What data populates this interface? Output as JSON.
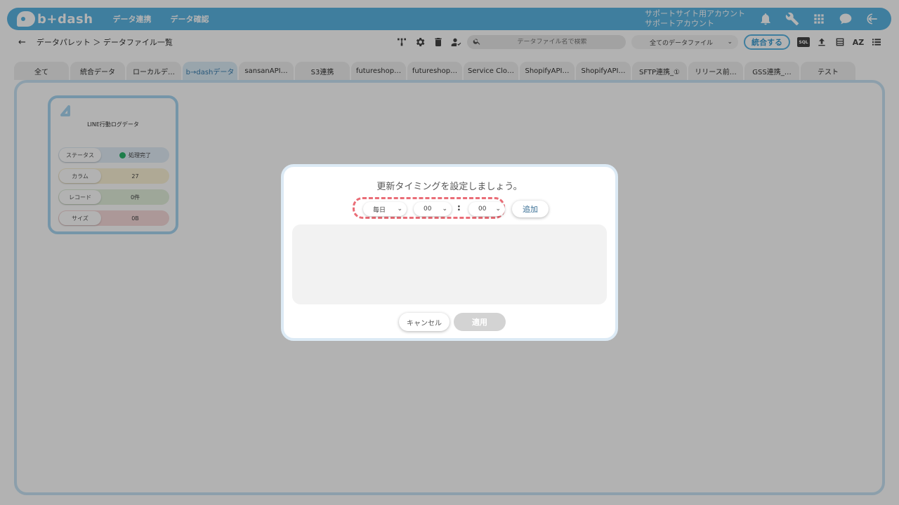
{
  "header": {
    "logo_text": "b+dash",
    "nav": [
      "データ連携",
      "データ確認"
    ],
    "account_line1": "サポートサイト用アカウント",
    "account_line2": "サポートアカウント",
    "icons": [
      "bell-icon",
      "wrench-icon",
      "grid-icon",
      "chat-icon",
      "logout-icon"
    ]
  },
  "subbar": {
    "back_icon": "←",
    "breadcrumb": "データパレット ＞ データファイル一覧",
    "search_placeholder": "データファイル名で検索",
    "filter_value": "全てのデータファイル",
    "merge_label": "統合する",
    "sql_label": "SQL"
  },
  "tabs": [
    "全て",
    "統合データ",
    "ローカルデ…",
    "b→dashデータ",
    "sansanAPI…",
    "S3連携",
    "futureshop…",
    "futureshop…",
    "Service Clo…",
    "ShopifyAPI…",
    "ShopifyAPI…",
    "SFTP連携_①",
    "リリース前…",
    "GSS連携_…",
    "テスト"
  ],
  "active_tab_index": 3,
  "card": {
    "title": "LINE行動ログデータ",
    "rows": [
      {
        "label": "ステータス",
        "value": "処理完了"
      },
      {
        "label": "カラム",
        "value": "27"
      },
      {
        "label": "レコード",
        "value": "0件"
      },
      {
        "label": "サイズ",
        "value": "0B"
      }
    ]
  },
  "modal": {
    "title": "更新タイミングを設定しましょう。",
    "frequency": "毎日",
    "hour": "00",
    "colon": ":",
    "minute": "00",
    "add_label": "追加",
    "cancel_label": "キャンセル",
    "apply_label": "適用"
  },
  "colors": {
    "brand": "#5bb5e3",
    "dashed_highlight": "#ea6d77",
    "status_ok": "#2bb36c"
  }
}
